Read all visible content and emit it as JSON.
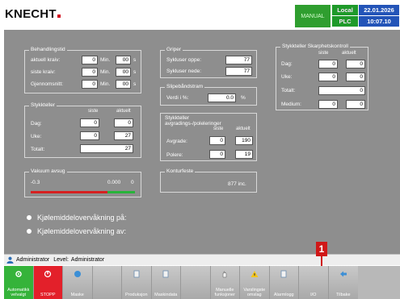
{
  "header": {
    "logo": "KNECHT",
    "mode": "MANUAL",
    "status": {
      "local": "Local",
      "date": "22.01.2026",
      "plc": "PLC",
      "time": "10:07.10"
    }
  },
  "behandlingstid": {
    "title": "Behandlingstid",
    "rows": [
      {
        "label": "aktuell kraiv:",
        "min": "0",
        "min_unit": "Min.",
        "sec": "00",
        "sec_unit": "s"
      },
      {
        "label": "siste kraiv:",
        "min": "0",
        "min_unit": "Min.",
        "sec": "00",
        "sec_unit": "s"
      },
      {
        "label": "Gjennomsnitt:",
        "min": "0",
        "min_unit": "Min.",
        "sec": "00",
        "sec_unit": "s"
      }
    ]
  },
  "stykkteller": {
    "title": "Stykkteller",
    "col_siste": "siste",
    "col_aktuelt": "aktuelt",
    "rows": [
      {
        "label": "Dag:",
        "siste": "0",
        "aktuelt": "0"
      },
      {
        "label": "Uke:",
        "siste": "0",
        "aktuelt": "27"
      },
      {
        "label": "Totalt:",
        "aktuelt": "27"
      }
    ]
  },
  "vakuum": {
    "title": "Vakuum avsug",
    "min_label": "-0.3",
    "value_label": "0.000",
    "max_label": "0"
  },
  "griper": {
    "title": "Griper",
    "rows": [
      {
        "label": "Sykluser oppe:",
        "value": "77"
      },
      {
        "label": "Sykluser nede:",
        "value": "77"
      }
    ]
  },
  "slipebandstram": {
    "title": "Slipebåndstram",
    "label": "Verdi i %:",
    "value": "0.0",
    "unit": "%"
  },
  "stykkteller_avgrad": {
    "title_line1": "Stykkteller",
    "title_line2": "avgradings-/poleleringer",
    "col_siste": "siste",
    "col_aktuelt": "aktuelt",
    "rows": [
      {
        "label": "Avgrade:",
        "siste": "0",
        "aktuelt": "190"
      },
      {
        "label": "Polere:",
        "siste": "0",
        "aktuelt": "19"
      }
    ]
  },
  "konturfeste": {
    "title": "Konturfeste",
    "value": "877 inc."
  },
  "skarphet": {
    "title": "Stykkteller Skarphetskontroll",
    "col_siste": "siste",
    "col_aktuelt": "aktuelt",
    "rows": [
      {
        "label": "Dag:",
        "siste": "0",
        "aktuelt": "0"
      },
      {
        "label": "Uke:",
        "siste": "0",
        "aktuelt": "0"
      },
      {
        "label": "Totalt:",
        "aktuelt": "0"
      },
      {
        "label": "Medium:",
        "siste": "0",
        "aktuelt": "0"
      }
    ]
  },
  "coolant": {
    "on_label": "Kjølemiddelovervåkning på:",
    "off_label": "Kjølemiddelovervåkning av:"
  },
  "userbar": {
    "user": "Administrator",
    "level_label": "Level:",
    "level_value": "Administrator"
  },
  "toolbar": {
    "buttons": [
      {
        "label": "Automatikk velvalgt",
        "color": "#35b33a",
        "icon": "gear-icon"
      },
      {
        "label": "STOPP",
        "color": "#e3202a",
        "icon": "stop-icon"
      },
      {
        "label": "Maske",
        "icon": "globe-icon"
      },
      {
        "label": "",
        "icon": ""
      },
      {
        "label": "Produksjon",
        "icon": "document-icon"
      },
      {
        "label": "Maskindata",
        "icon": "document-icon"
      },
      {
        "label": "",
        "icon": ""
      },
      {
        "label": "Manuelle funksjoner",
        "icon": "hand-icon"
      },
      {
        "label": "Varslingste omslag",
        "icon": "warning-icon"
      },
      {
        "label": "Alarmlogg",
        "icon": "document-icon"
      },
      {
        "label": "I/O",
        "icon": ""
      },
      {
        "label": "Tilbake",
        "icon": "arrow-back-icon"
      }
    ]
  },
  "callout": {
    "number": "1"
  }
}
